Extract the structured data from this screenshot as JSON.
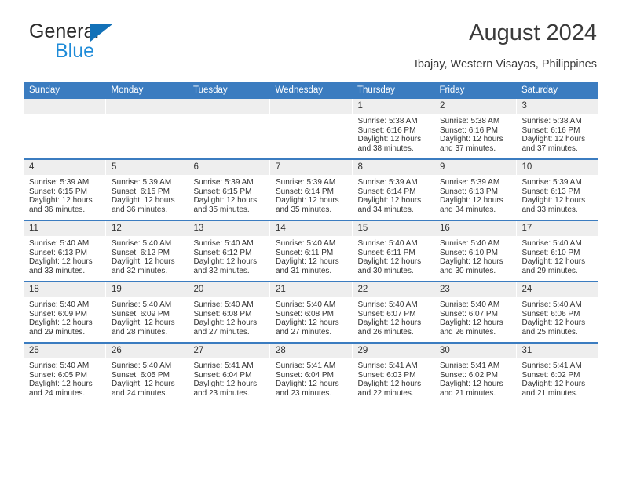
{
  "brand": {
    "name_line1": "General",
    "name_line2": "Blue",
    "triangle_color": "#1271b8",
    "blue_text_color": "#1e8bd8"
  },
  "header": {
    "title": "August 2024",
    "subtitle": "Ibajay, Western Visayas, Philippines"
  },
  "theme": {
    "header_bg": "#3b7cc0",
    "daynum_bg": "#eeeeee",
    "cell_bg": "#ffffff",
    "text": "#333333"
  },
  "weekday_headers": [
    "Sunday",
    "Monday",
    "Tuesday",
    "Wednesday",
    "Thursday",
    "Friday",
    "Saturday"
  ],
  "labels": {
    "sunrise_prefix": "Sunrise:",
    "sunset_prefix": "Sunset:",
    "daylight_prefix": "Daylight:"
  },
  "weeks": [
    [
      {
        "day": "",
        "line1": "",
        "line2": "",
        "line3": "",
        "line4": ""
      },
      {
        "day": "",
        "line1": "",
        "line2": "",
        "line3": "",
        "line4": ""
      },
      {
        "day": "",
        "line1": "",
        "line2": "",
        "line3": "",
        "line4": ""
      },
      {
        "day": "",
        "line1": "",
        "line2": "",
        "line3": "",
        "line4": ""
      },
      {
        "day": "1",
        "line1": "Sunrise: 5:38 AM",
        "line2": "Sunset: 6:16 PM",
        "line3": "Daylight: 12 hours",
        "line4": "and 38 minutes."
      },
      {
        "day": "2",
        "line1": "Sunrise: 5:38 AM",
        "line2": "Sunset: 6:16 PM",
        "line3": "Daylight: 12 hours",
        "line4": "and 37 minutes."
      },
      {
        "day": "3",
        "line1": "Sunrise: 5:38 AM",
        "line2": "Sunset: 6:16 PM",
        "line3": "Daylight: 12 hours",
        "line4": "and 37 minutes."
      }
    ],
    [
      {
        "day": "4",
        "line1": "Sunrise: 5:39 AM",
        "line2": "Sunset: 6:15 PM",
        "line3": "Daylight: 12 hours",
        "line4": "and 36 minutes."
      },
      {
        "day": "5",
        "line1": "Sunrise: 5:39 AM",
        "line2": "Sunset: 6:15 PM",
        "line3": "Daylight: 12 hours",
        "line4": "and 36 minutes."
      },
      {
        "day": "6",
        "line1": "Sunrise: 5:39 AM",
        "line2": "Sunset: 6:15 PM",
        "line3": "Daylight: 12 hours",
        "line4": "and 35 minutes."
      },
      {
        "day": "7",
        "line1": "Sunrise: 5:39 AM",
        "line2": "Sunset: 6:14 PM",
        "line3": "Daylight: 12 hours",
        "line4": "and 35 minutes."
      },
      {
        "day": "8",
        "line1": "Sunrise: 5:39 AM",
        "line2": "Sunset: 6:14 PM",
        "line3": "Daylight: 12 hours",
        "line4": "and 34 minutes."
      },
      {
        "day": "9",
        "line1": "Sunrise: 5:39 AM",
        "line2": "Sunset: 6:13 PM",
        "line3": "Daylight: 12 hours",
        "line4": "and 34 minutes."
      },
      {
        "day": "10",
        "line1": "Sunrise: 5:39 AM",
        "line2": "Sunset: 6:13 PM",
        "line3": "Daylight: 12 hours",
        "line4": "and 33 minutes."
      }
    ],
    [
      {
        "day": "11",
        "line1": "Sunrise: 5:40 AM",
        "line2": "Sunset: 6:13 PM",
        "line3": "Daylight: 12 hours",
        "line4": "and 33 minutes."
      },
      {
        "day": "12",
        "line1": "Sunrise: 5:40 AM",
        "line2": "Sunset: 6:12 PM",
        "line3": "Daylight: 12 hours",
        "line4": "and 32 minutes."
      },
      {
        "day": "13",
        "line1": "Sunrise: 5:40 AM",
        "line2": "Sunset: 6:12 PM",
        "line3": "Daylight: 12 hours",
        "line4": "and 32 minutes."
      },
      {
        "day": "14",
        "line1": "Sunrise: 5:40 AM",
        "line2": "Sunset: 6:11 PM",
        "line3": "Daylight: 12 hours",
        "line4": "and 31 minutes."
      },
      {
        "day": "15",
        "line1": "Sunrise: 5:40 AM",
        "line2": "Sunset: 6:11 PM",
        "line3": "Daylight: 12 hours",
        "line4": "and 30 minutes."
      },
      {
        "day": "16",
        "line1": "Sunrise: 5:40 AM",
        "line2": "Sunset: 6:10 PM",
        "line3": "Daylight: 12 hours",
        "line4": "and 30 minutes."
      },
      {
        "day": "17",
        "line1": "Sunrise: 5:40 AM",
        "line2": "Sunset: 6:10 PM",
        "line3": "Daylight: 12 hours",
        "line4": "and 29 minutes."
      }
    ],
    [
      {
        "day": "18",
        "line1": "Sunrise: 5:40 AM",
        "line2": "Sunset: 6:09 PM",
        "line3": "Daylight: 12 hours",
        "line4": "and 29 minutes."
      },
      {
        "day": "19",
        "line1": "Sunrise: 5:40 AM",
        "line2": "Sunset: 6:09 PM",
        "line3": "Daylight: 12 hours",
        "line4": "and 28 minutes."
      },
      {
        "day": "20",
        "line1": "Sunrise: 5:40 AM",
        "line2": "Sunset: 6:08 PM",
        "line3": "Daylight: 12 hours",
        "line4": "and 27 minutes."
      },
      {
        "day": "21",
        "line1": "Sunrise: 5:40 AM",
        "line2": "Sunset: 6:08 PM",
        "line3": "Daylight: 12 hours",
        "line4": "and 27 minutes."
      },
      {
        "day": "22",
        "line1": "Sunrise: 5:40 AM",
        "line2": "Sunset: 6:07 PM",
        "line3": "Daylight: 12 hours",
        "line4": "and 26 minutes."
      },
      {
        "day": "23",
        "line1": "Sunrise: 5:40 AM",
        "line2": "Sunset: 6:07 PM",
        "line3": "Daylight: 12 hours",
        "line4": "and 26 minutes."
      },
      {
        "day": "24",
        "line1": "Sunrise: 5:40 AM",
        "line2": "Sunset: 6:06 PM",
        "line3": "Daylight: 12 hours",
        "line4": "and 25 minutes."
      }
    ],
    [
      {
        "day": "25",
        "line1": "Sunrise: 5:40 AM",
        "line2": "Sunset: 6:05 PM",
        "line3": "Daylight: 12 hours",
        "line4": "and 24 minutes."
      },
      {
        "day": "26",
        "line1": "Sunrise: 5:40 AM",
        "line2": "Sunset: 6:05 PM",
        "line3": "Daylight: 12 hours",
        "line4": "and 24 minutes."
      },
      {
        "day": "27",
        "line1": "Sunrise: 5:41 AM",
        "line2": "Sunset: 6:04 PM",
        "line3": "Daylight: 12 hours",
        "line4": "and 23 minutes."
      },
      {
        "day": "28",
        "line1": "Sunrise: 5:41 AM",
        "line2": "Sunset: 6:04 PM",
        "line3": "Daylight: 12 hours",
        "line4": "and 23 minutes."
      },
      {
        "day": "29",
        "line1": "Sunrise: 5:41 AM",
        "line2": "Sunset: 6:03 PM",
        "line3": "Daylight: 12 hours",
        "line4": "and 22 minutes."
      },
      {
        "day": "30",
        "line1": "Sunrise: 5:41 AM",
        "line2": "Sunset: 6:02 PM",
        "line3": "Daylight: 12 hours",
        "line4": "and 21 minutes."
      },
      {
        "day": "31",
        "line1": "Sunrise: 5:41 AM",
        "line2": "Sunset: 6:02 PM",
        "line3": "Daylight: 12 hours",
        "line4": "and 21 minutes."
      }
    ]
  ]
}
